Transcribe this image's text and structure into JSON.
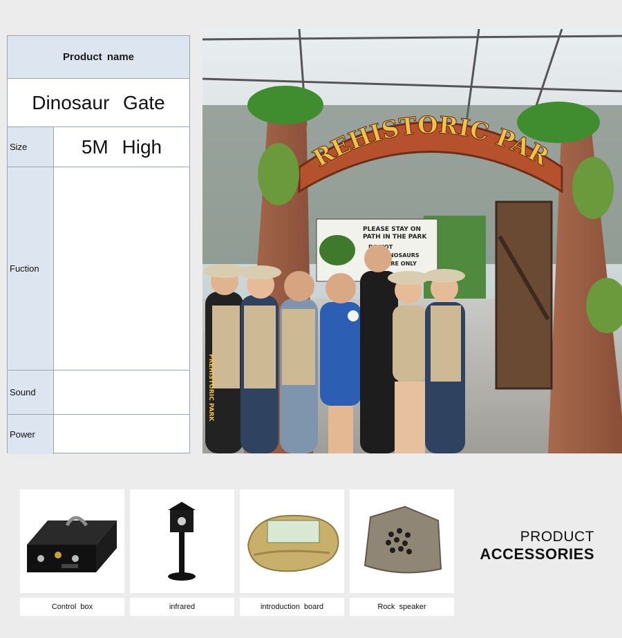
{
  "spec_table": {
    "header": "Product  name",
    "product_name": "Dinosaur  Gate",
    "rows": [
      {
        "label": "Size",
        "value": "5M  High"
      },
      {
        "label": "Fuction",
        "value": ""
      },
      {
        "label": "Sound",
        "value": ""
      },
      {
        "label": "Power",
        "value": ""
      }
    ]
  },
  "photo": {
    "arch_sign": "PREHISTORIC PARK",
    "banner_lines": [
      "PLEASE STAY ON",
      "PATH IN THE PARK",
      "DO NOT",
      "THE DINOSAURS",
      "THEY ARE ONLY"
    ],
    "vest_text": "PREHISTORIC PARK"
  },
  "accessories": {
    "title_line1": "PRODUCT",
    "title_line2": "ACCESSORIES",
    "items": [
      {
        "caption": "Control  box",
        "icon": "control-box-icon"
      },
      {
        "caption": "infrared",
        "icon": "infrared-sensor-icon"
      },
      {
        "caption": "introduction  board",
        "icon": "introduction-board-icon"
      },
      {
        "caption": "Rock  speaker",
        "icon": "rock-speaker-icon"
      }
    ]
  },
  "colors": {
    "table_header_bg": "#dde5f0",
    "table_border": "#9aa3b3",
    "arch_red": "#b5522d",
    "arch_text": "#f0c24a"
  }
}
